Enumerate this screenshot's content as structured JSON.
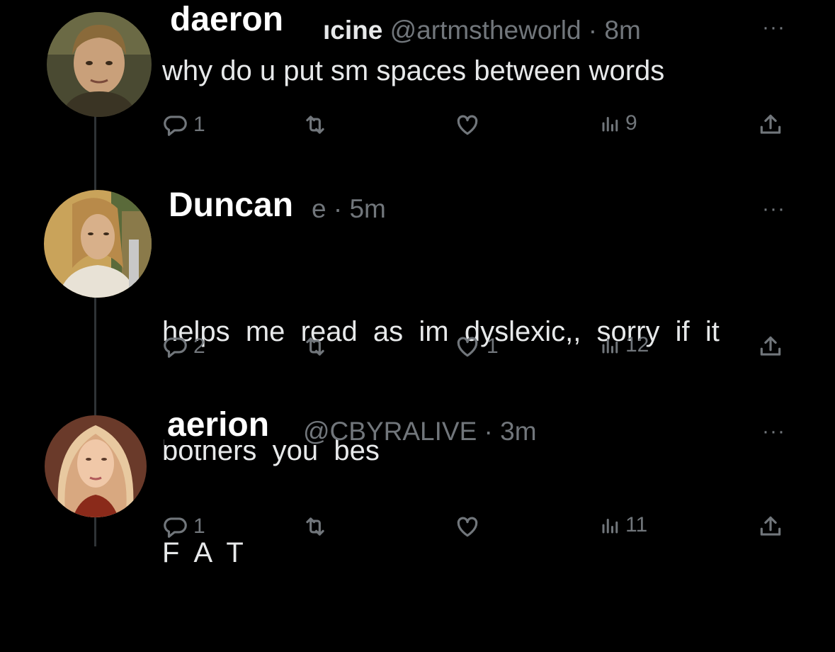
{
  "tweets": [
    {
      "overlay_name": "daeron",
      "display_name_visible": "ıcine",
      "handle_time": "@artmstheworld · 8m",
      "more": "···",
      "text_lines": [
        "why do u put sm spaces between words"
      ],
      "replies": "1",
      "reposts": "",
      "likes": "",
      "views": "9"
    },
    {
      "overlay_name": "Duncan",
      "display_name_visible": "",
      "handle_time": "e · 5m",
      "more": "···",
      "text_lines": [
        "helps  me  read  as  im  dyslexic,,  sorry  if  it",
        "bothers  you  bes"
      ],
      "replies": "2",
      "reposts": "",
      "likes": "1",
      "views": "12"
    },
    {
      "overlay_name": "aerion",
      "display_name_visible": "",
      "handle_time": "@CBYRALIVE · 3m",
      "more": "···",
      "text_lines": [
        "F  A  T"
      ],
      "replies": "1",
      "reposts": "",
      "likes": "",
      "views": "11"
    }
  ],
  "icons": {
    "reply": "reply-icon",
    "repost": "repost-icon",
    "like": "like-icon",
    "views": "views-icon",
    "share": "share-icon"
  },
  "colors": {
    "background": "#000000",
    "text": "#e7e9ea",
    "muted": "#71767b",
    "thread": "#2f3336"
  }
}
